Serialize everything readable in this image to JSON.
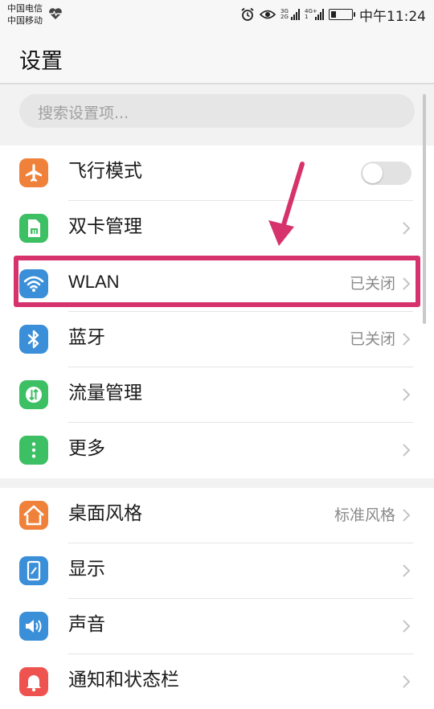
{
  "status_bar": {
    "carrier1": "中国电信",
    "carrier2": "中国移动",
    "net1": "3G 2G",
    "net2": "4G+ 1",
    "time": "中午11:24",
    "battery_level": 0.25
  },
  "header": {
    "title": "设置"
  },
  "search": {
    "placeholder": "搜索设置项..."
  },
  "settings": {
    "group1": [
      {
        "label": "飞行模式",
        "icon": "airplane-icon",
        "color": "#f0813a",
        "control": "toggle",
        "on": false
      },
      {
        "label": "双卡管理",
        "icon": "sim-card-icon",
        "color": "#3dbf63",
        "control": "chevron"
      },
      {
        "label": "WLAN",
        "icon": "wifi-icon",
        "color": "#3a8fd8",
        "value": "已关闭",
        "control": "chevron"
      },
      {
        "label": "蓝牙",
        "icon": "bluetooth-icon",
        "color": "#3a8fd8",
        "value": "已关闭",
        "control": "chevron"
      },
      {
        "label": "流量管理",
        "icon": "data-usage-icon",
        "color": "#3dbf63",
        "control": "chevron"
      },
      {
        "label": "更多",
        "icon": "more-icon",
        "color": "#3dbf63",
        "control": "chevron"
      }
    ],
    "group2": [
      {
        "label": "桌面风格",
        "icon": "home-icon",
        "color": "#f0813a",
        "value": "标准风格",
        "control": "chevron"
      },
      {
        "label": "显示",
        "icon": "display-icon",
        "color": "#3a8fd8",
        "control": "chevron"
      },
      {
        "label": "声音",
        "icon": "sound-icon",
        "color": "#3a8fd8",
        "control": "chevron"
      },
      {
        "label": "通知和状态栏",
        "icon": "notification-icon",
        "color": "#ef5350",
        "control": "chevron"
      }
    ]
  },
  "annotation": {
    "color": "#d6336c",
    "target": "WLAN"
  }
}
